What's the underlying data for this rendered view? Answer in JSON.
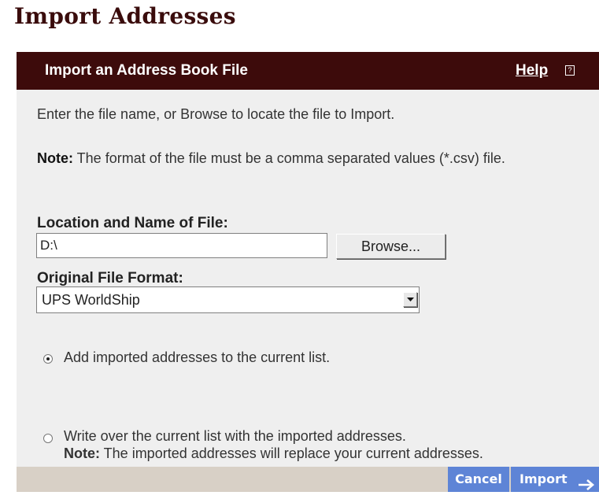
{
  "page_title": "Import Addresses",
  "panel": {
    "title": "Import an Address Book File",
    "help_label": "Help",
    "help_icon": "question-box-icon"
  },
  "instructions": "Enter the file name, or Browse to locate the file to Import.",
  "note": {
    "prefix": "Note:",
    "text": " The format of the file must be a comma separated values (*.csv) file."
  },
  "file": {
    "label": "Location and Name of File:",
    "value": "D:\\",
    "browse_label": "Browse..."
  },
  "format": {
    "label": "Original File Format:",
    "selected": "UPS WorldShip"
  },
  "options": {
    "add": {
      "label": "Add imported addresses to the current list.",
      "checked": true
    },
    "overwrite": {
      "label": "Write over the current list with the imported addresses.",
      "note_prefix": "Note:",
      "note_text": " The imported addresses will replace your current addresses.",
      "checked": false
    }
  },
  "footer": {
    "cancel_label": "Cancel",
    "import_label": "Import"
  },
  "colors": {
    "header_bg": "#3d0b0b",
    "panel_bg": "#efefef",
    "button_bg": "#5e84d6",
    "footer_bg": "#d8d0c6"
  }
}
